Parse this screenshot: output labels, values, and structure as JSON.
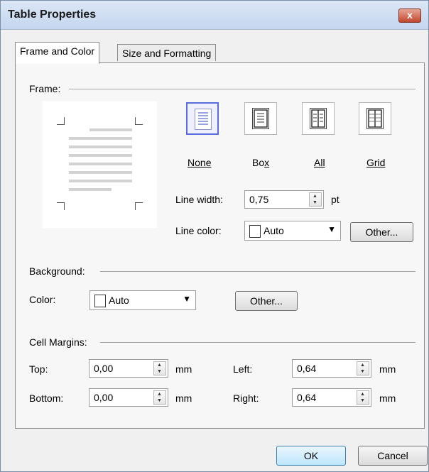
{
  "window": {
    "title": "Table Properties",
    "close_label": "x"
  },
  "tabs": [
    {
      "label": "Frame and Color"
    },
    {
      "label": "Size and Formatting"
    }
  ],
  "frame": {
    "label": "Frame:",
    "options": [
      {
        "pre": "",
        "ul": "N",
        "post": "one"
      },
      {
        "pre": "Bo",
        "ul": "x",
        "post": ""
      },
      {
        "pre": "",
        "ul": "A",
        "post": "ll"
      },
      {
        "pre": "",
        "ul": "G",
        "post": "rid"
      }
    ],
    "line_width_label": "Line width:",
    "line_width_value": "0,75",
    "line_width_unit": "pt",
    "line_color_label": "Line color:",
    "line_color_value": "Auto",
    "line_color_other": "Other..."
  },
  "background": {
    "label": "Background:",
    "color_label": "Color:",
    "color_value": "Auto",
    "other": "Other..."
  },
  "margins": {
    "label": "Cell Margins:",
    "top_label": "Top:",
    "top_value": "0,00",
    "bottom_label": "Bottom:",
    "bottom_value": "0,00",
    "left_label": "Left:",
    "left_value": "0,64",
    "right_label": "Right:",
    "right_value": "0,64",
    "unit": "mm"
  },
  "buttons": {
    "ok": "OK",
    "cancel": "Cancel"
  }
}
